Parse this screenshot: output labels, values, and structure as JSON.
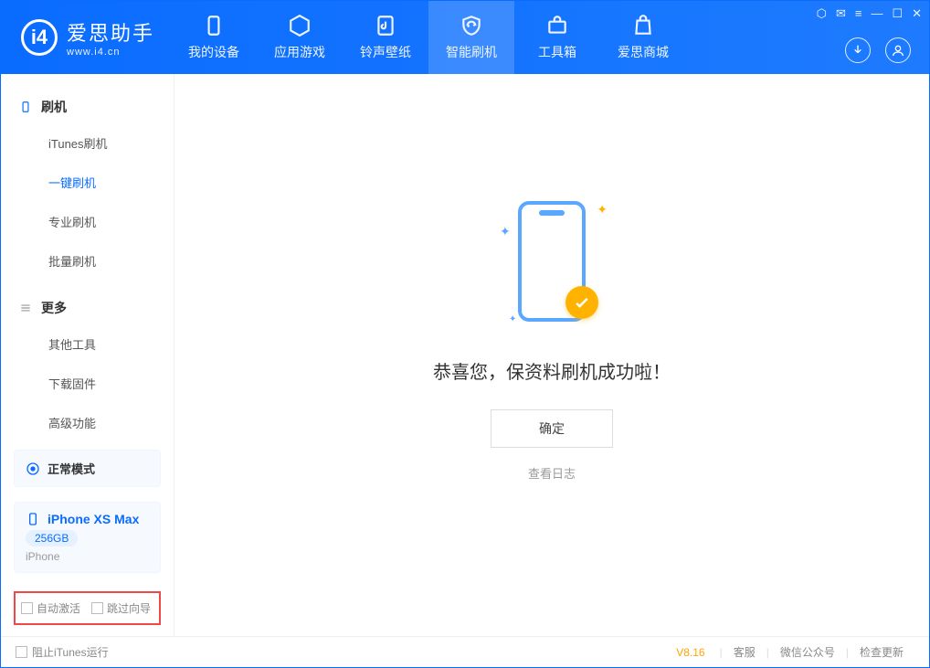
{
  "app": {
    "name": "爱思助手",
    "url": "www.i4.cn"
  },
  "tabs": [
    {
      "label": "我的设备"
    },
    {
      "label": "应用游戏"
    },
    {
      "label": "铃声壁纸"
    },
    {
      "label": "智能刷机"
    },
    {
      "label": "工具箱"
    },
    {
      "label": "爱思商城"
    }
  ],
  "sidebar": {
    "section1": "刷机",
    "items1": [
      {
        "label": "iTunes刷机"
      },
      {
        "label": "一键刷机"
      },
      {
        "label": "专业刷机"
      },
      {
        "label": "批量刷机"
      }
    ],
    "section2": "更多",
    "items2": [
      {
        "label": "其他工具"
      },
      {
        "label": "下载固件"
      },
      {
        "label": "高级功能"
      }
    ],
    "mode": "正常模式",
    "device": {
      "name": "iPhone XS Max",
      "capacity": "256GB",
      "sub": "iPhone"
    },
    "cb1": "自动激活",
    "cb2": "跳过向导"
  },
  "main": {
    "success": "恭喜您，保资料刷机成功啦！",
    "ok": "确定",
    "log": "查看日志"
  },
  "footer": {
    "stopItunes": "阻止iTunes运行",
    "version": "V8.16",
    "links": [
      "客服",
      "微信公众号",
      "检查更新"
    ]
  }
}
